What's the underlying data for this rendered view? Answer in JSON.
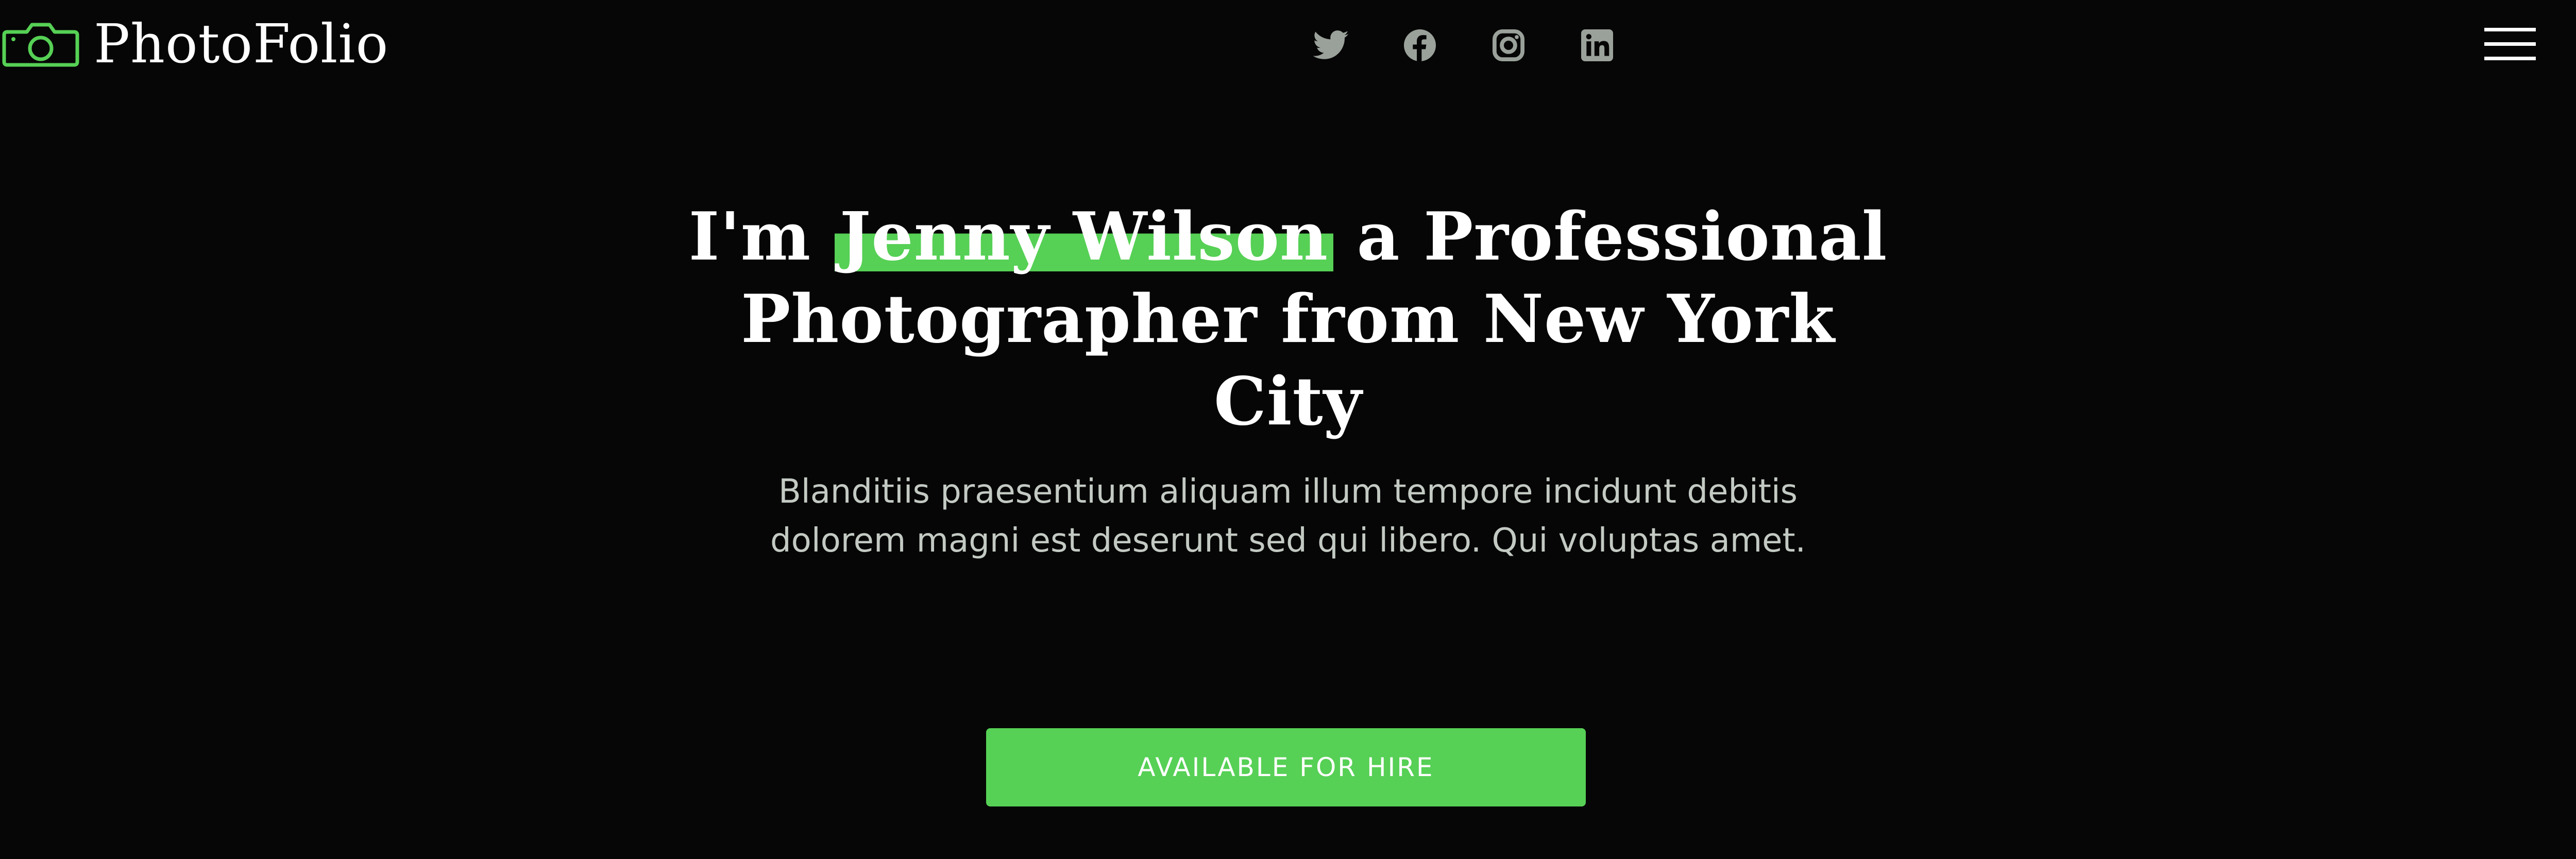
{
  "header": {
    "logo_text": "PhotoFolio",
    "logo_icon": "camera-icon",
    "socials": [
      {
        "name": "twitter",
        "icon": "twitter-icon"
      },
      {
        "name": "facebook",
        "icon": "facebook-icon"
      },
      {
        "name": "instagram",
        "icon": "instagram-icon"
      },
      {
        "name": "linkedin",
        "icon": "linkedin-icon"
      }
    ],
    "menu_icon": "hamburger-menu-icon"
  },
  "hero": {
    "title_prefix": "I'm ",
    "title_highlight": "Jenny Wilson",
    "title_suffix": " a Professional Photographer from New York City",
    "subtitle": "Blanditiis praesentium aliquam illum tempore incidunt debitis dolorem magni est deserunt sed qui libero. Qui voluptas amet.",
    "cta_label": "AVAILABLE FOR HIRE"
  },
  "colors": {
    "background": "#060606",
    "accent": "#56d055",
    "icon_gray": "#9aa09a",
    "text": "#ffffff",
    "subtitle": "#c3c9c3"
  }
}
